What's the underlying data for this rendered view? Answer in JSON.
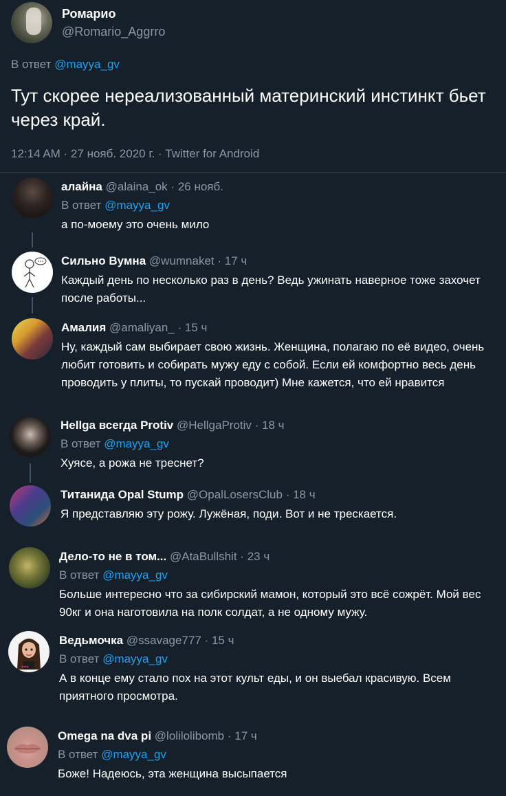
{
  "main_tweet": {
    "author_name": "Ромарио",
    "author_handle": "@Romario_Aggrro",
    "reply_prefix": "В ответ",
    "reply_to": "@mayya_gv",
    "text": "Тут скорее нереализованный материнский инстинкт бьет через край.",
    "meta": "12:14 AM · 27 нояб. 2020 г. · Twitter for Android"
  },
  "replies": [
    {
      "name": "алайна",
      "handle": "@alaina_ok",
      "time": "26 нояб.",
      "reply_prefix": "В ответ",
      "reply_to": "@mayya_gv",
      "text": "а по-моему это очень мило"
    },
    {
      "name": "Сильно Вумна",
      "handle": "@wumnaket",
      "time": "17 ч",
      "text": "Каждый день по несколько раз в день? Ведь ужинать наверное тоже захочет после работы..."
    },
    {
      "name": "Амалия",
      "handle": "@amaliyan_",
      "time": "15 ч",
      "text": "Ну, каждый сам выбирает свою жизнь. Женщина, полагаю по её видео, очень любит готовить и собирать мужу еду с собой. Если ей комфортно весь день проводить у плиты, то пускай проводит) Мне кажется, что ей нравится"
    },
    {
      "name": "Hellga всегда Protiv",
      "handle": "@HellgaProtiv",
      "time": "18 ч",
      "reply_prefix": "В ответ",
      "reply_to": "@mayya_gv",
      "text": "Хуясе, а рожа не треснет?"
    },
    {
      "name": "Титанида Opal Stump",
      "handle": "@OpalLosersClub",
      "time": "18 ч",
      "text": "Я представляю эту рожу. Лужёная, поди. Вот и не трескается."
    },
    {
      "name": "Дело-то не в том...",
      "handle": "@AtaBullshit",
      "time": "23 ч",
      "reply_prefix": "В ответ",
      "reply_to": "@mayya_gv",
      "text": "Больше интересно что за сибирский мамон, который это всё сожрёт. Мой вес 90кг и она наготовила на полк солдат, а не одному мужу."
    },
    {
      "name": "Ведьмочка",
      "handle": "@ssavage777",
      "time": "15 ч",
      "reply_prefix": "В ответ",
      "reply_to": "@mayya_gv",
      "text": "А в конце ему стало пох на этот культ еды, и он выебал красивую. Всем приятного просмотра."
    },
    {
      "name": "Omega na dva pi",
      "handle": "@lolilolibomb",
      "time": "17 ч",
      "reply_prefix": "В ответ",
      "reply_to": "@mayya_gv",
      "text": "Боже! Надеюсь, эта женщина высыпается"
    }
  ],
  "separator": "·",
  "colors": {
    "background": "#15202b",
    "text_primary": "#ffffff",
    "text_secondary": "#8899a6",
    "link": "#1da1f2",
    "divider": "#38444d",
    "thread_line": "#3d5466"
  }
}
